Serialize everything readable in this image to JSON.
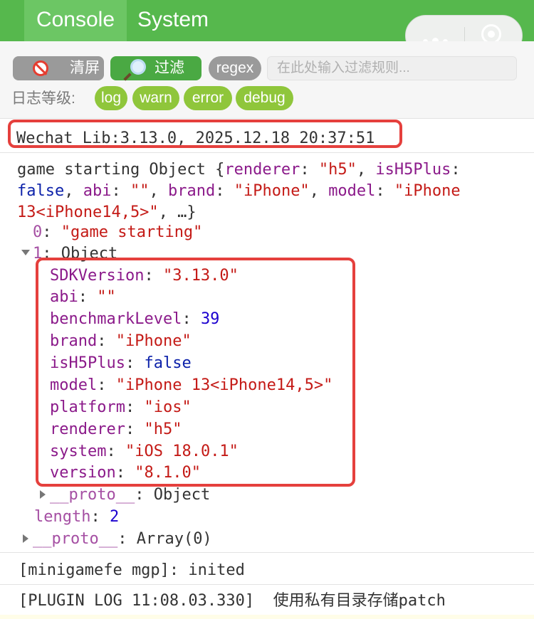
{
  "tabs": {
    "console": "Console",
    "system": "System"
  },
  "capsule": {
    "more_icon": "more-dots-icon",
    "close_icon": "target-circle-icon"
  },
  "toolbar": {
    "clear_label": "清屏",
    "filter_label": "过滤",
    "regex_label": "regex",
    "filter_placeholder": "在此处输入过滤规则...",
    "level_label": "日志等级:",
    "levels": [
      "log",
      "warn",
      "error",
      "debug"
    ]
  },
  "colors": {
    "header": "#56b84d",
    "tab_active": "#6cc664",
    "level_pill": "#8fc63b",
    "highlight": "#e5403d",
    "string": "#c41a16",
    "key": "#8b1a8a"
  },
  "log": {
    "lib_line": "Wechat Lib:3.13.0, 2025.12.18 20:37:51",
    "game": {
      "prefix": "game starting Object {",
      "renderer_k": "renderer",
      "renderer_v": "\"h5\"",
      "ish5_k": "isH5Plus",
      "ish5_v": "false",
      "abi_k": "abi",
      "abi_v": "\"\"",
      "brand_k": "brand",
      "brand_v": "\"iPhone\"",
      "model_k": "model",
      "model_v1": "\"iPhone",
      "model_v2": "13<iPhone14,5>\"",
      "ellipsis": ", …}",
      "idx0_k": "0",
      "idx0_v": "\"game starting\"",
      "idx1_k": "1",
      "idx1_v": "Object"
    },
    "props": [
      {
        "k": "SDKVersion",
        "v": "\"3.13.0\"",
        "t": "s"
      },
      {
        "k": "abi",
        "v": "\"\"",
        "t": "s"
      },
      {
        "k": "benchmarkLevel",
        "v": "39",
        "t": "n"
      },
      {
        "k": "brand",
        "v": "\"iPhone\"",
        "t": "s"
      },
      {
        "k": "isH5Plus",
        "v": "false",
        "t": "b"
      },
      {
        "k": "model",
        "v": "\"iPhone 13<iPhone14,5>\"",
        "t": "s"
      },
      {
        "k": "platform",
        "v": "\"ios\"",
        "t": "s"
      },
      {
        "k": "renderer",
        "v": "\"h5\"",
        "t": "s"
      },
      {
        "k": "system",
        "v": "\"iOS 18.0.1\"",
        "t": "s"
      },
      {
        "k": "version",
        "v": "\"8.1.0\"",
        "t": "s"
      }
    ],
    "proto_inner_k": "__proto__",
    "proto_inner_v": "Object",
    "length_k": "length",
    "length_v": "2",
    "proto_outer_k": "__proto__",
    "proto_outer_v": "Array(0)",
    "mgp_line": "[minigamefe mgp]: inited",
    "plugin_line": "[PLUGIN LOG 11:08.03.330]  使用私有目录存储patch"
  }
}
